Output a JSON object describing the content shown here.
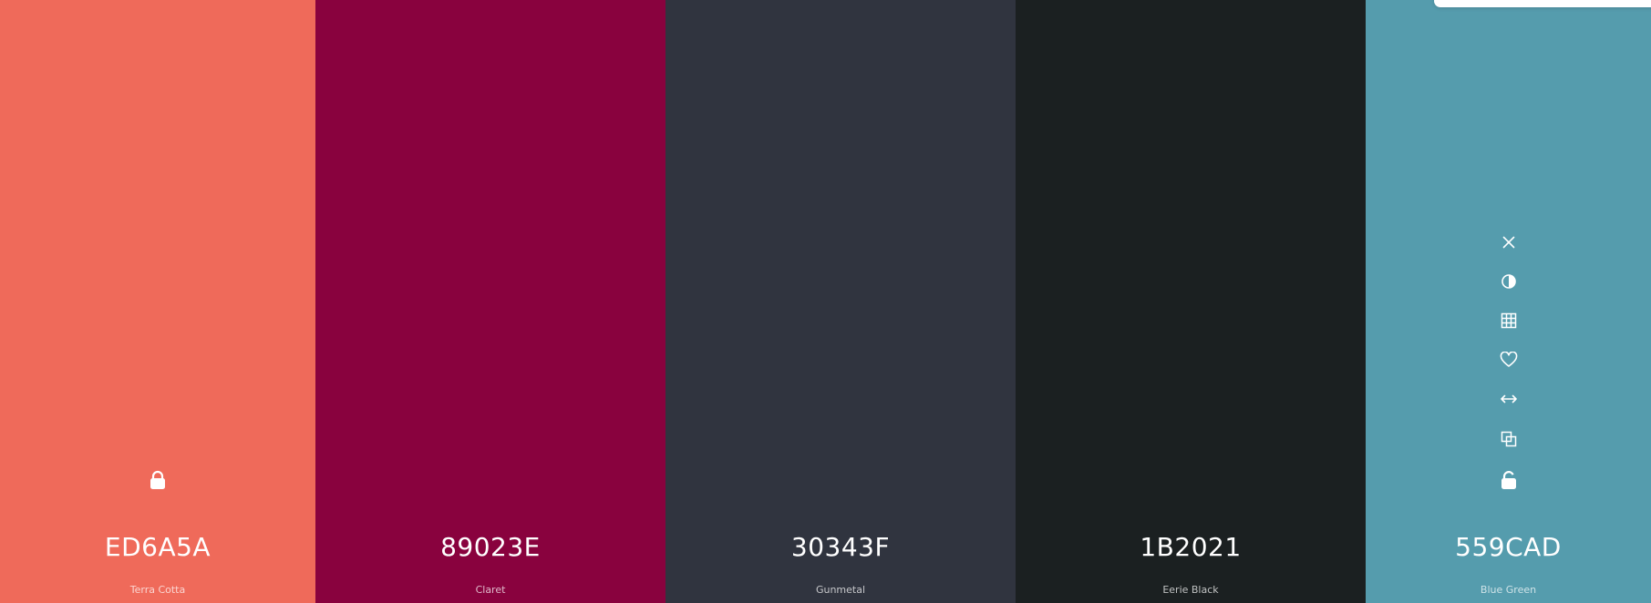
{
  "swatches": [
    {
      "hex": "ED6A5A",
      "name": "Terra Cotta",
      "color": "#EF6A5A",
      "locked": true
    },
    {
      "hex": "89023E",
      "name": "Claret",
      "color": "#89023E",
      "locked": false
    },
    {
      "hex": "30343F",
      "name": "Gunmetal",
      "color": "#30343F",
      "locked": false
    },
    {
      "hex": "1B2021",
      "name": "Eerie Black",
      "color": "#1B2021",
      "locked": false
    },
    {
      "hex": "559CAD",
      "name": "Blue Green",
      "color": "#559CAD",
      "locked": false
    }
  ],
  "toolbar_icons": [
    "close-icon",
    "contrast-icon",
    "shades-grid-icon",
    "heart-icon",
    "drag-arrows-icon",
    "copy-icon",
    "unlock-icon"
  ],
  "lock_icon": "lock-icon"
}
